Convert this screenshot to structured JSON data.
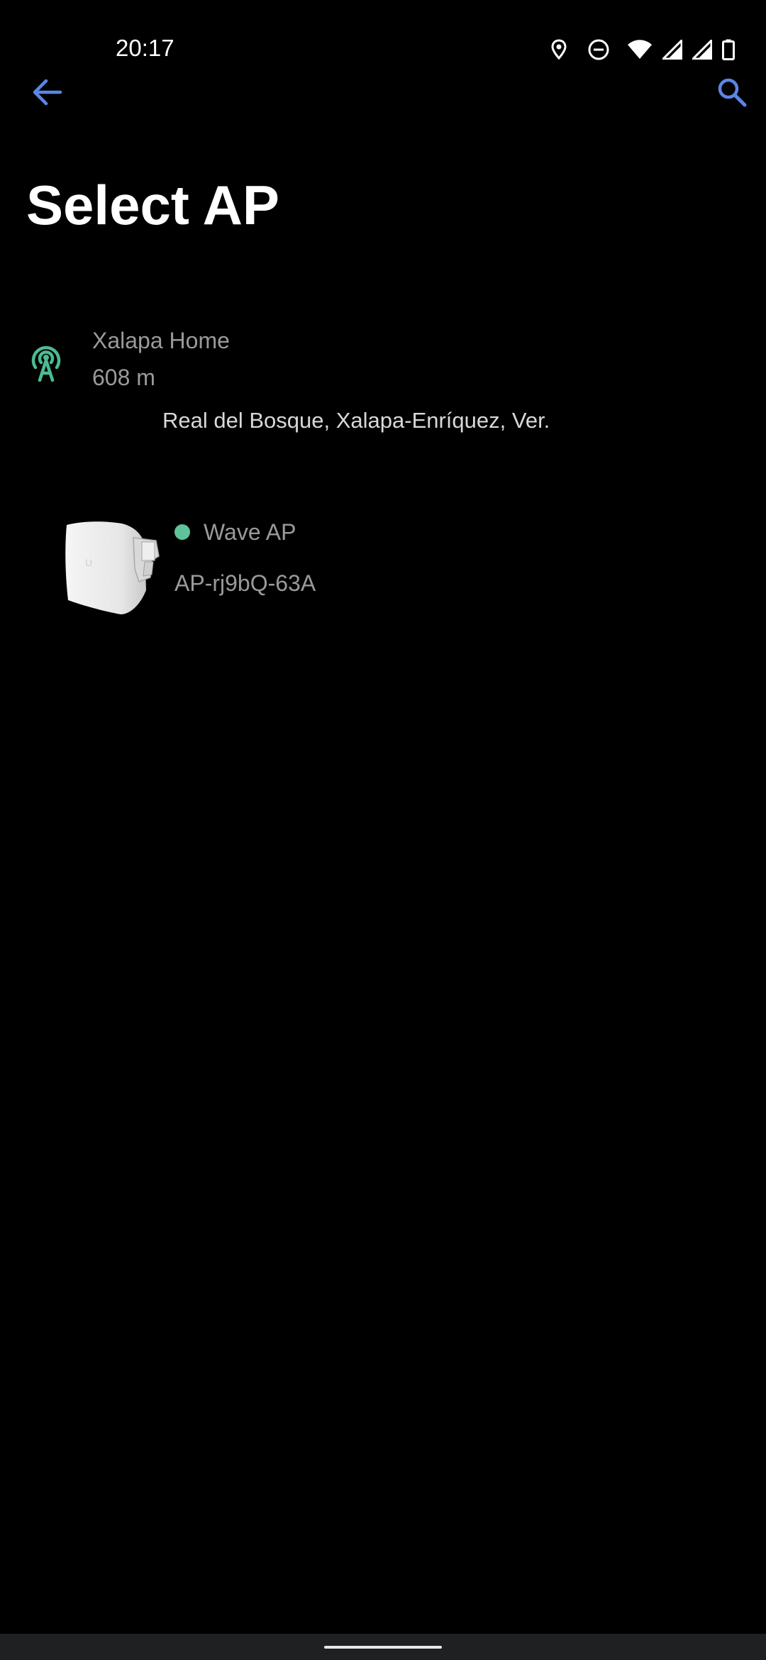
{
  "status_bar": {
    "time": "20:17",
    "icons": [
      "location-icon",
      "do-not-disturb-icon",
      "wifi-icon",
      "signal-icon",
      "signal-icon",
      "battery-icon"
    ]
  },
  "app_bar": {
    "back_icon": "arrow-left-icon",
    "search_icon": "search-icon",
    "accent_color": "#5b86e5"
  },
  "page": {
    "title": "Select AP"
  },
  "site": {
    "icon": "antenna-broadcast-icon",
    "icon_color": "#4dba91",
    "name": "Xalapa Home",
    "distance": "608 m",
    "address": "Real del Bosque, Xalapa-Enríquez, Ver."
  },
  "devices": [
    {
      "image": "wave-ap-device-image",
      "status_color": "#5fc39a",
      "model": "Wave AP",
      "name": "AP-rj9bQ-63A"
    }
  ]
}
